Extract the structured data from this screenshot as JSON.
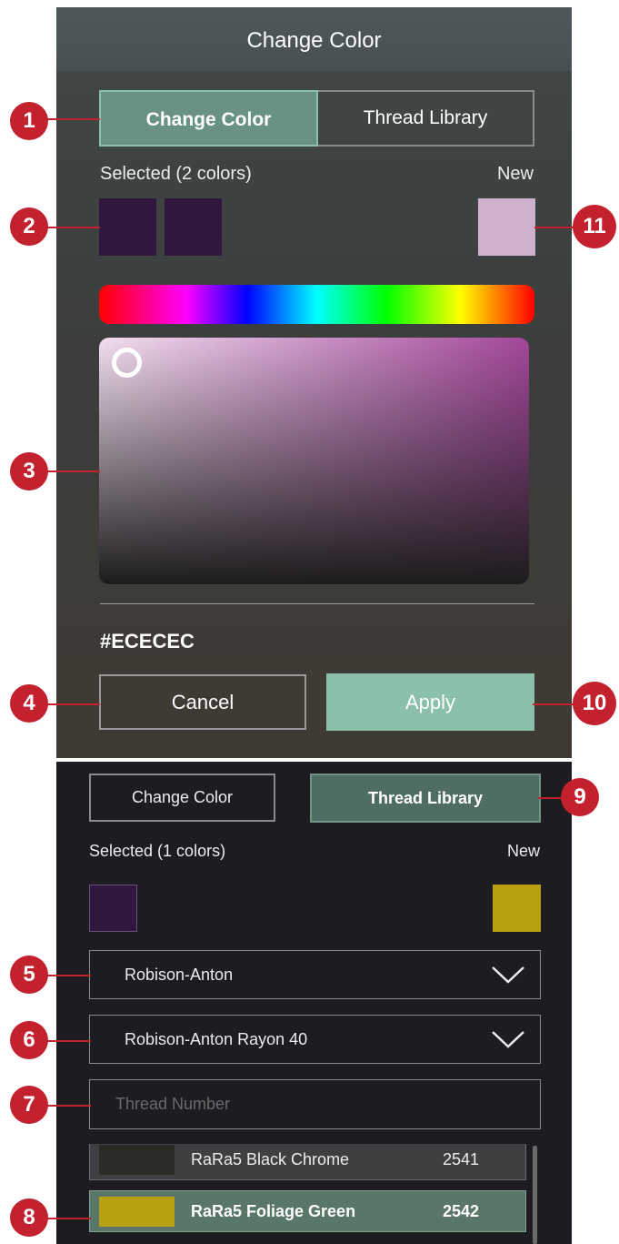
{
  "colors": {
    "panel_bg": "#3d4040",
    "header_bg": "#4e5759",
    "accent_tab": "#6a9283",
    "apply_button": "#8bc0ab",
    "selected_swatch": "#2f173d",
    "new_swatch_panel1": "#cfb1cd",
    "new_swatch_panel2": "#b8a011",
    "callout_red": "#c3212e",
    "thread_panel_bg": "#1d1c21",
    "row1_swatch": "#2a2b26",
    "row2_swatch": "#b8a011"
  },
  "panel1": {
    "header_title": "Change Color",
    "tabs": [
      {
        "label": "Change Color",
        "active": true
      },
      {
        "label": "Thread Library",
        "active": false
      }
    ],
    "selected_label": "Selected (2 colors)",
    "new_label": "New",
    "hex_value": "#ECECEC",
    "cancel_label": "Cancel",
    "apply_label": "Apply"
  },
  "panel2": {
    "tabs": [
      {
        "label": "Change Color",
        "active": false
      },
      {
        "label": "Thread Library",
        "active": true
      }
    ],
    "selected_label": "Selected (1 colors)",
    "new_label": "New",
    "brand_dropdown": "Robison-Anton",
    "type_dropdown": "Robison-Anton Rayon 40",
    "search_placeholder": "Thread Number",
    "threads": [
      {
        "name": "RaRa5 Black Chrome",
        "number": "2541",
        "selected": false
      },
      {
        "name": "RaRa5 Foliage Green",
        "number": "2542",
        "selected": true
      }
    ]
  },
  "callouts": [
    "1",
    "2",
    "3",
    "4",
    "5",
    "6",
    "7",
    "8",
    "9",
    "10",
    "11"
  ],
  "icons": {
    "dropdown": "chevron-down-icon",
    "picker_handle": "circle-handle-icon"
  }
}
